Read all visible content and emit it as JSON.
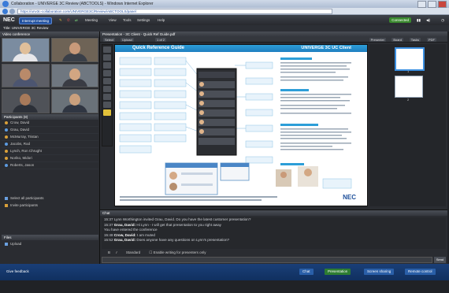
{
  "window": {
    "title": "Collaboration - UNIVERGE 3C Review (ABCTOOLS) - Windows Internet Explorer",
    "url": "https://unv3c-collaboration.com/UNIVERGE3C/Review/ABCTOOLS/panel"
  },
  "toolbar": {
    "logo": "NEC",
    "meeting_button": "Interrupt meeting",
    "menus": [
      "Meeting",
      "View",
      "Tools",
      "Settings",
      "Help"
    ],
    "status_pill": "Connected"
  },
  "session": {
    "title": "Title: UNIVERGE 3C Review"
  },
  "left": {
    "video_header": "Video conference",
    "video_tiles": [
      {
        "name": "",
        "skin": "#e0bf9a",
        "shirt": "#e7e7ea",
        "bg": "#7b8ca0"
      },
      {
        "name": "",
        "skin": "#c99a7a",
        "shirt": "#3a3f48",
        "bg": "#6e6356"
      },
      {
        "name": "",
        "skin": "#b98a6a",
        "shirt": "#4c5570",
        "bg": "#5d5f66"
      },
      {
        "name": "",
        "skin": "#d2a682",
        "shirt": "#3a3c44",
        "bg": "#6f7780"
      },
      {
        "name": "",
        "skin": "#a87a5a",
        "shirt": "#2c3038",
        "bg": "#4f5258"
      },
      {
        "name": "",
        "skin": "#caa07d",
        "shirt": "#303642",
        "bg": "#6a7279"
      }
    ],
    "participants_header": "Participants (8)",
    "participants": [
      {
        "name": "Crow, David",
        "color": "#d9a03a"
      },
      {
        "name": "Grau, David",
        "color": "#5c9be0"
      },
      {
        "name": "McMurray, Tristan",
        "color": "#d9a03a"
      },
      {
        "name": "Jacobs, Rod",
        "color": "#5c9be0"
      },
      {
        "name": "Lynch, Ron Chrught",
        "color": "#d9a03a"
      },
      {
        "name": "Noriko, Midori",
        "color": "#d9a03a"
      },
      {
        "name": "Roberts, Jason",
        "color": "#5c9be0"
      }
    ],
    "select_all": "Select all participants",
    "invite": "Invite participants",
    "files_header": "Files",
    "upload": "Upload"
  },
  "presentation": {
    "header": "Presentation - 3C Client - Quick Ref Guide.pdf",
    "toolbar": [
      "Select",
      "Upload",
      "1 of 2",
      "Presenter",
      "Board",
      "Tasks",
      "PDF"
    ],
    "slide": {
      "title_left": "Quick Reference Guide",
      "title_right": "UNIVERGE 3C UC Client",
      "footer_brand": "NEC"
    },
    "thumbs": [
      "1",
      "2"
    ]
  },
  "chat": {
    "header": "Chat",
    "messages": [
      {
        "time": "15:37",
        "sender": "",
        "text": "Lynn Worthington invited Grau, David. Do you have the latest customer presentation?"
      },
      {
        "time": "15:37",
        "sender": "Grau, David:",
        "text": "Hi Lynn - I will get that presentation to you right away"
      },
      {
        "time": "",
        "sender": "",
        "text": "You have entered the conference"
      },
      {
        "time": "15:48",
        "sender": "Crow, David:",
        "text": "I am muted"
      },
      {
        "time": "15:52",
        "sender": "Grau, David:",
        "text": "Does anyone have any questions on Lynn's presentation?"
      }
    ],
    "format": "Standard",
    "enable_label": "Enable writing for presenters only",
    "send": "Send"
  },
  "status": {
    "left": "Give feedback",
    "buttons": [
      "Chat",
      "Presentation",
      "Screen sharing",
      "Remote control"
    ]
  }
}
